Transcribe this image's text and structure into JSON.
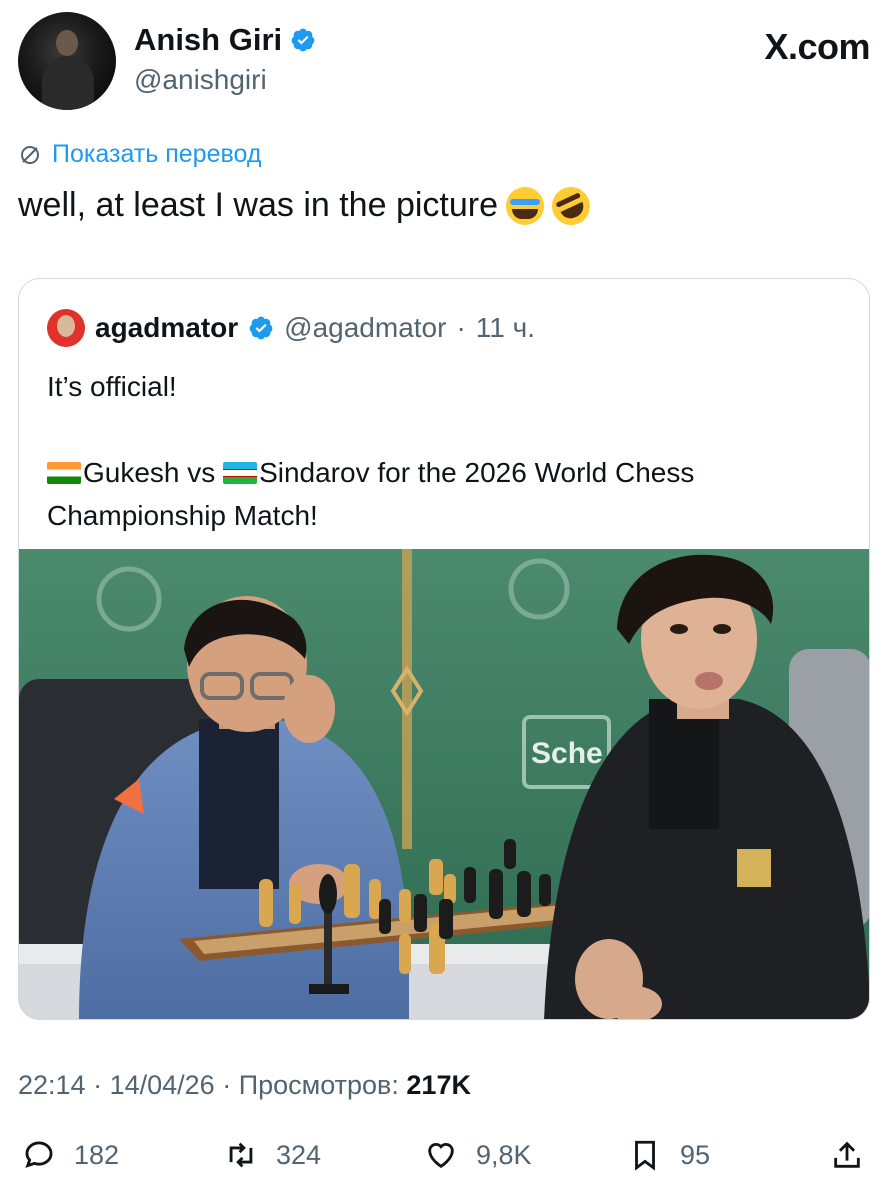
{
  "author": {
    "name": "Anish Giri",
    "handle": "@anishgiri"
  },
  "brand": "X.com",
  "translate_label": "Показать перевод",
  "tweet_text": "well, at least I was in the picture",
  "quoted": {
    "name": "agadmator",
    "handle": "@agadmator",
    "separator": "·",
    "time": "11 ч.",
    "line1": "It’s official!",
    "line2_a": "Gukesh vs ",
    "line2_b": "Sindarov for the 2026 World Chess",
    "line3": "Championship Match!"
  },
  "meta": {
    "time": "22:14",
    "date": "14/04/26",
    "views_label": "Просмотров:",
    "views": "217K"
  },
  "actions": {
    "replies": "182",
    "reposts": "324",
    "likes": "9,8K",
    "bookmarks": "95"
  },
  "colors": {
    "accent": "#1d9bf0",
    "muted": "#536471",
    "text": "#0f1419",
    "border": "#cfd9de"
  },
  "photo": {
    "sign_text": "Sche"
  }
}
